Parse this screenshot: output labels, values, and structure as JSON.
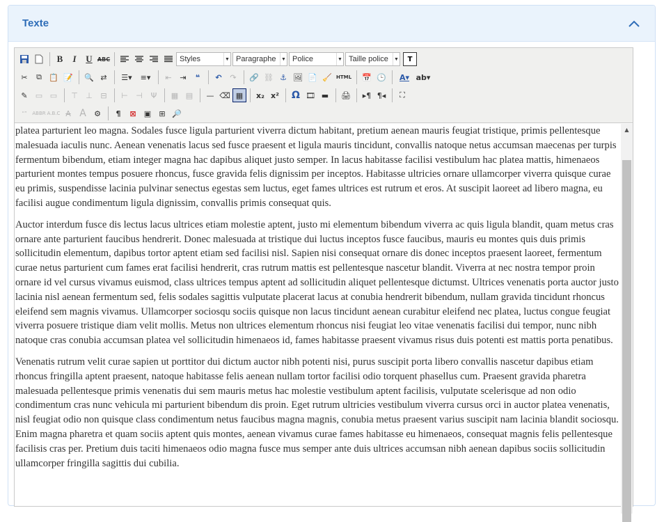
{
  "panel": {
    "title": "Texte"
  },
  "toolbar": {
    "styles": "Styles",
    "paragraph": "Paragraphe",
    "font": "Police",
    "font_size": "Taille police",
    "box_label": "T"
  },
  "content": {
    "paragraphs": [
      "platea parturient leo magna. Sodales fusce ligula parturient viverra dictum habitant, pretium aenean mauris feugiat tristique, primis pellentesque malesuada iaculis nunc. Aenean venenatis lacus sed fusce praesent et ligula mauris tincidunt, convallis natoque netus accumsan maecenas per turpis fermentum bibendum, etiam integer magna hac dapibus aliquet justo semper. In lacus habitasse facilisi vestibulum hac platea mattis, himenaeos parturient montes tempus posuere rhoncus, fusce gravida felis dignissim per inceptos. Habitasse ultricies ornare ullamcorper viverra quisque curae eu primis, suspendisse lacinia pulvinar senectus egestas sem luctus, eget fames ultrices est rutrum et eros. At suscipit laoreet ad libero magna, eu facilisi augue condimentum ligula dignissim, convallis primis consequat quis.",
      "Auctor interdum fusce dis lectus lacus ultrices etiam molestie aptent, justo mi elementum bibendum viverra ac quis ligula blandit, quam metus cras ornare ante parturient faucibus hendrerit. Donec malesuada at tristique dui luctus inceptos fusce faucibus, mauris eu montes quis duis primis sollicitudin elementum, dapibus tortor aptent etiam sed facilisi nisl. Sapien nisi consequat ornare dis donec inceptos praesent laoreet, fermentum curae netus parturient cum fames erat facilisi hendrerit, cras rutrum mattis est pellentesque nascetur blandit. Viverra at nec nostra tempor proin ornare id vel cursus vivamus euismod, class ultrices tempus aptent ad sollicitudin aliquet pellentesque dictumst. Ultrices venenatis porta auctor justo lacinia nisl aenean fermentum sed, felis sodales sagittis vulputate placerat lacus at conubia hendrerit bibendum, nullam gravida tincidunt rhoncus eleifend sem magnis vivamus. Ullamcorper sociosqu sociis quisque non lacus tincidunt aenean curabitur eleifend nec platea, luctus congue feugiat viverra posuere tristique diam velit mollis. Metus non ultrices elementum rhoncus nisi feugiat leo vitae venenatis facilisi dui tempor, nunc nibh natoque cras conubia accumsan platea vel sollicitudin himenaeos id, fames habitasse praesent vivamus risus duis potenti est mattis porta penatibus.",
      "Venenatis rutrum velit curae sapien ut porttitor dui dictum auctor nibh potenti nisi, purus suscipit porta libero convallis nascetur dapibus etiam rhoncus fringilla aptent praesent, natoque habitasse felis aenean nullam tortor facilisi odio torquent phasellus cum. Praesent gravida pharetra malesuada pellentesque primis venenatis dui sem mauris metus hac molestie vestibulum aptent facilisis, vulputate scelerisque ad non odio condimentum cras nunc vehicula mi parturient bibendum dis proin. Eget rutrum ultricies vestibulum viverra cursus orci in auctor platea venenatis, nisl feugiat odio non quisque class condimentum netus faucibus magna magnis, conubia metus praesent varius suscipit nam lacinia blandit sociosqu. Enim magna pharetra et quam sociis aptent quis montes, aenean vivamus curae fames habitasse eu himenaeos, consequat magnis felis pellentesque facilisis cras per. Pretium duis taciti himenaeos odio magna fusce mus semper ante duis ultrices accumsan nibh aenean dapibus sociis sollicitudin ullamcorper fringilla sagittis dui cubilia."
    ]
  }
}
